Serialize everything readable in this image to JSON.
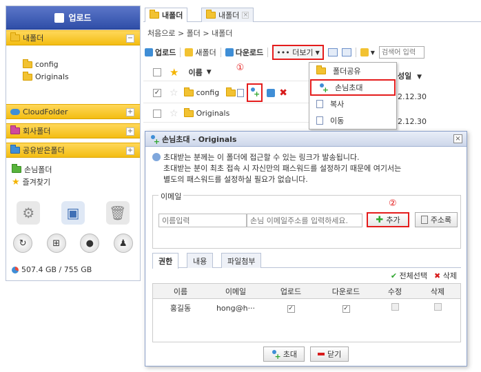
{
  "sidebar": {
    "upload_label": "업로드",
    "my_folder": "내폴더",
    "tree": [
      "config",
      "Originals"
    ],
    "cloud_folder": "CloudFolder",
    "company_folder": "회사폴더",
    "shared_in_folder": "공유받은폴더",
    "guest_folder": "손님폴더",
    "favorites": "즐겨찾기",
    "storage": "507.4 GB / 755 GB"
  },
  "tabs": [
    {
      "label": "내폴더"
    },
    {
      "label": "내폴더"
    }
  ],
  "breadcrumb": "처음으로  >  폴더  >  내폴더",
  "toolbar": {
    "upload": "업로드",
    "new_folder": "새폴더",
    "download": "다운로드",
    "more": "••• 더보기",
    "search_placeholder": "검색어 입력"
  },
  "filelist": {
    "col_name": "이름",
    "col_date": "성일",
    "rows": [
      {
        "name": "config",
        "date": "2.12.30",
        "checked": true
      },
      {
        "name": "Originals",
        "date": "2.12.30",
        "checked": false
      }
    ]
  },
  "markers": {
    "one": "①",
    "two": "②"
  },
  "dropdown": {
    "items": [
      "폴더공유",
      "손님초대",
      "복사",
      "이동"
    ]
  },
  "dialog": {
    "title": "손님초대 - Originals",
    "info_line1": "초대받는 분께는 이 폴더에 접근할 수 있는 링크가 발송됩니다.",
    "info_line2": "초대받는 분이 최초 접속 시 자신만의 패스워드를 설정하기 때문에 여기서는",
    "info_line3": "별도의 패스워드를 설정하실 필요가 없습니다.",
    "email_legend": "이메일",
    "name_placeholder": "이름입력",
    "email_placeholder": "손님 이메일주소를 입력하세요.",
    "add_button": "추가",
    "addressbook_button": "주소록",
    "tabs": [
      "권한",
      "내용",
      "파일첨부"
    ],
    "select_all": "전체선택",
    "delete": "삭제",
    "columns": [
      "이름",
      "이메일",
      "업로드",
      "다운로드",
      "수정",
      "삭제"
    ],
    "rows": [
      {
        "name": "홍길동",
        "email": "hong@h···",
        "upload": true,
        "download": true,
        "modify": false,
        "delete": false
      }
    ],
    "invite_button": "초대",
    "close_button": "닫기"
  },
  "colors": {
    "accent_red": "#e41b1b",
    "header_blue": "#2f4ea7",
    "gold": "#f3bd12"
  }
}
